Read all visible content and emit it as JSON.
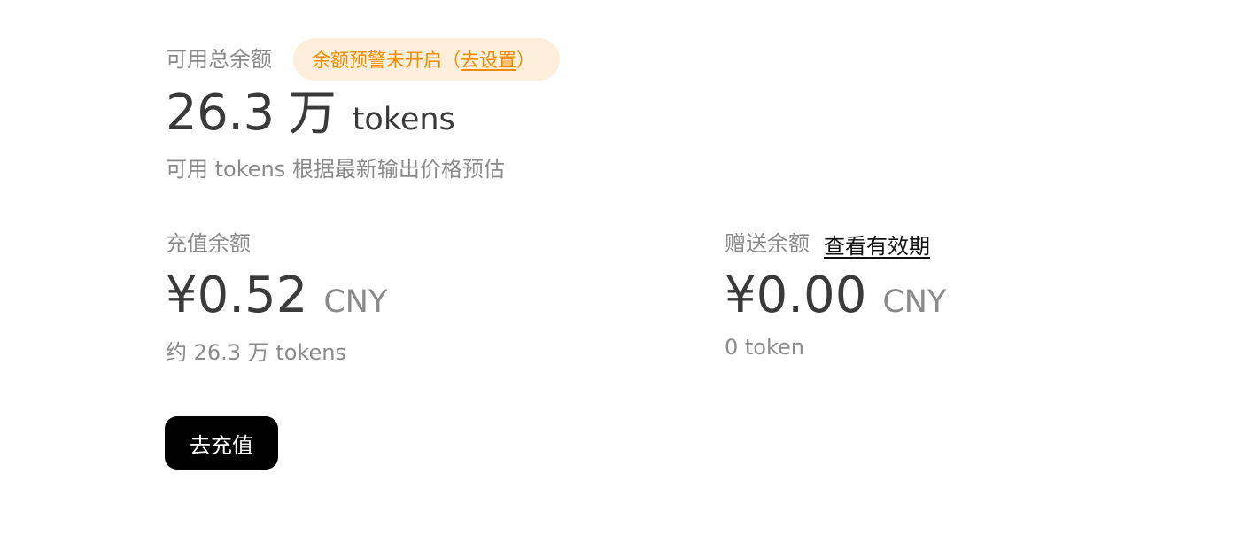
{
  "total": {
    "label": "可用总余额",
    "alert": {
      "text": "余额预警未开启（",
      "link_label": "去设置",
      "close_paren": "）"
    },
    "amount": "26.3",
    "amount_unit": "万",
    "tokens_unit": "tokens",
    "note": "可用 tokens 根据最新输出价格预估"
  },
  "recharge_balance": {
    "label": "充值余额",
    "amount": "¥0.52",
    "currency": "CNY",
    "token_estimate": "约 26.3 万 tokens"
  },
  "gift_balance": {
    "label": "赠送余额",
    "expiry_link": "查看有效期",
    "amount": "¥0.00",
    "currency": "CNY",
    "token_estimate": "0 token"
  },
  "actions": {
    "recharge_button": "去充值"
  },
  "colors": {
    "primary_text": "#3a3a3a",
    "secondary_text": "#8a8a8a",
    "alert_text": "#f08c00",
    "alert_bg": "#fdefdc",
    "button_bg": "#000000"
  }
}
